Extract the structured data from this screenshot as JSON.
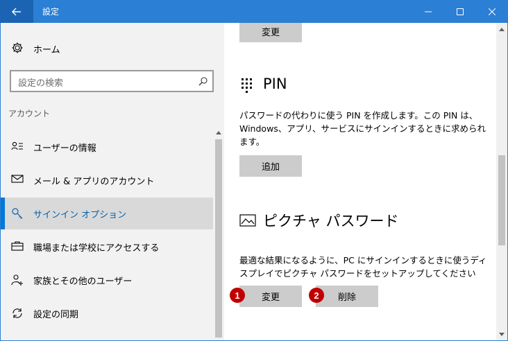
{
  "window": {
    "title": "設定"
  },
  "sidebar": {
    "home_label": "ホーム",
    "search_placeholder": "設定の検索",
    "section_header": "アカウント",
    "items": [
      {
        "label": "ユーザーの情報",
        "icon": "user-info-icon"
      },
      {
        "label": "メール & アプリのアカウント",
        "icon": "mail-icon"
      },
      {
        "label": "サインイン オプション",
        "icon": "key-icon",
        "selected": true
      },
      {
        "label": "職場または学校にアクセスする",
        "icon": "briefcase-icon"
      },
      {
        "label": "家族とその他のユーザー",
        "icon": "add-user-icon"
      },
      {
        "label": "設定の同期",
        "icon": "sync-icon"
      }
    ]
  },
  "main": {
    "top_button_label": "変更",
    "pin": {
      "title": "PIN",
      "description": "パスワードの代わりに使う PIN を作成します。この PIN は、Windows、アプリ、サービスにサインインするときに求められます。",
      "add_label": "追加"
    },
    "picture_password": {
      "title": "ピクチャ パスワード",
      "description": "最適な結果になるように、PC にサインインするときに使うディスプレイでピクチャ パスワードをセットアップしてください",
      "change_label": "変更",
      "delete_label": "削除",
      "badge_1": "1",
      "badge_2": "2"
    }
  },
  "colors": {
    "titlebar": "#2b7fd4",
    "accent": "#0078d7",
    "badge": "#c00000"
  }
}
